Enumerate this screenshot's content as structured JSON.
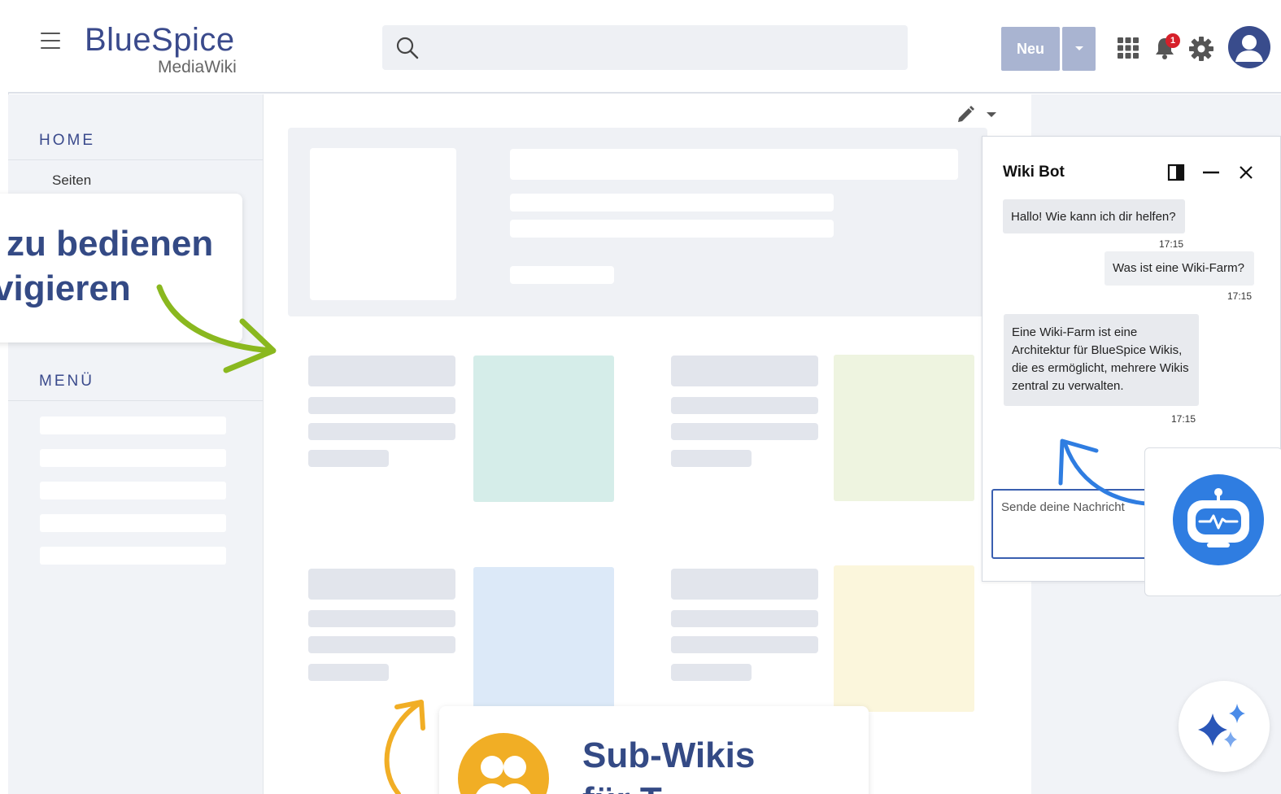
{
  "header": {
    "logo_main": "BlueSpice",
    "logo_sub": "MediaWiki",
    "new_button_label": "Neu",
    "notification_count": "1",
    "icons": [
      "menu-icon",
      "search-icon",
      "chevron-down-icon",
      "apps-grid-icon",
      "bell-icon",
      "gear-icon",
      "user-avatar-icon"
    ]
  },
  "sidebar": {
    "home_heading": "HOME",
    "home_link": "Seiten",
    "menu_heading": "MENÜ"
  },
  "callouts": {
    "left_line1": "zu bedienen",
    "left_line2": "vigieren",
    "bottom_line1": "Sub-Wikis",
    "bottom_line2": "für T..."
  },
  "bot": {
    "title": "Wiki Bot",
    "messages": [
      {
        "from": "bot",
        "text": "Hallo! Wie kann ich dir helfen?",
        "time": "17:15"
      },
      {
        "from": "user",
        "text": "Was ist eine Wiki-Farm?",
        "time": "17:15"
      },
      {
        "from": "bot",
        "text": "Eine Wiki-Farm ist eine Architektur für BlueSpice Wikis, die es ermöglicht, mehrere Wikis zentral zu verwalten.",
        "time": "17:15"
      }
    ],
    "input_placeholder": "Sende deine Nachricht"
  },
  "colors": {
    "brand_blue": "#3a4a8c",
    "accent_green": "#8ab81f",
    "accent_blue": "#2f7de1",
    "accent_orange": "#f1ae25",
    "badge_red": "#d6202a",
    "tile_teal": "#d5ede9",
    "tile_lime": "#eef4e0",
    "tile_blue": "#dce9f8",
    "tile_yellow": "#fbf6dc"
  }
}
